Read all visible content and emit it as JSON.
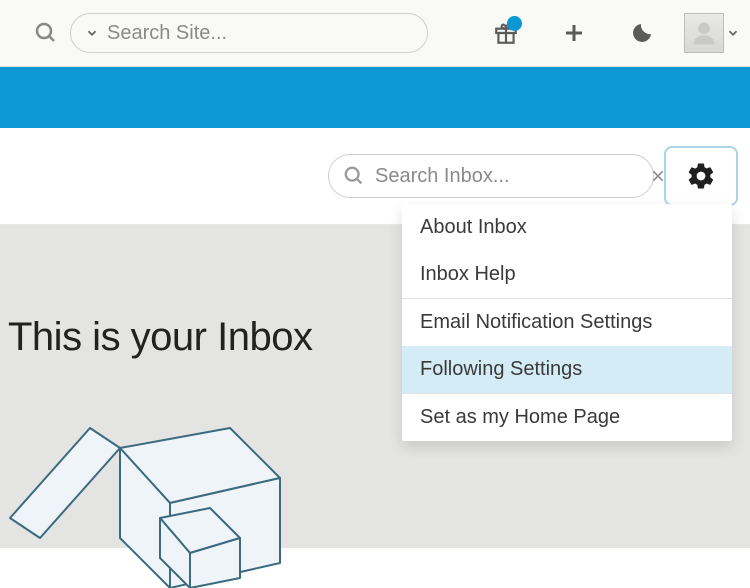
{
  "topbar": {
    "site_search_placeholder": "Search Site..."
  },
  "subhead": {
    "inbox_search_placeholder": "Search Inbox..."
  },
  "content": {
    "heading": "This is your Inbox"
  },
  "menu": {
    "about": "About Inbox",
    "help": "Inbox Help",
    "email_settings": "Email Notification Settings",
    "following_settings": "Following Settings",
    "set_home": "Set as my Home Page"
  }
}
